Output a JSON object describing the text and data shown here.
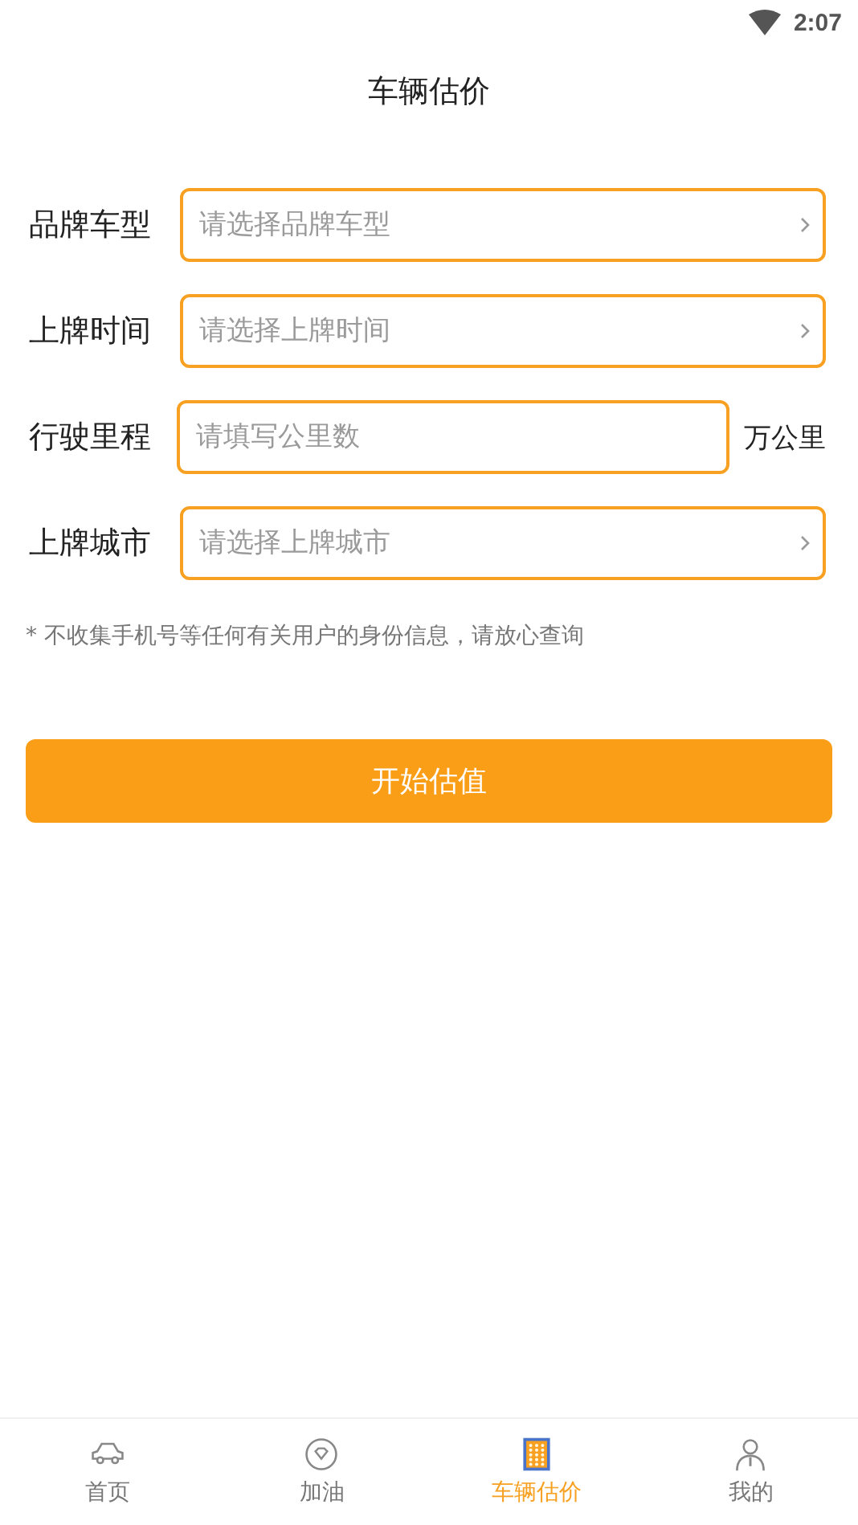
{
  "status_bar": {
    "time": "2:07"
  },
  "title": "车辆估价",
  "fields": [
    {
      "kind": "select",
      "label": "品牌车型",
      "placeholder": "请选择品牌车型"
    },
    {
      "kind": "select",
      "label": "上牌时间",
      "placeholder": "请选择上牌时间"
    },
    {
      "kind": "input",
      "label": "行驶里程",
      "placeholder": "请填写公里数",
      "unit": "万公里"
    },
    {
      "kind": "select",
      "label": "上牌城市",
      "placeholder": "请选择上牌城市"
    }
  ],
  "note": "* 不收集手机号等任何有关用户的身份信息，请放心查询",
  "submit_button": "开始估值",
  "tabs": [
    {
      "label": "首页",
      "selected": false
    },
    {
      "label": "加油",
      "selected": false
    },
    {
      "label": "车辆估价",
      "selected": true
    },
    {
      "label": "我的",
      "selected": false
    }
  ]
}
